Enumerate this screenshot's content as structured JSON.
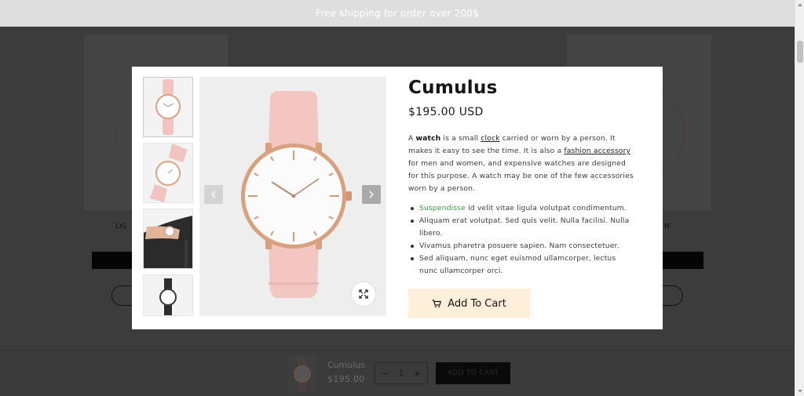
{
  "announcement": {
    "text": "Free shipping for order over 200$"
  },
  "modal": {
    "title": "Cumulus",
    "price": "$195.00 USD",
    "description": {
      "p1": "A ",
      "watch": "watch",
      "p2": " is a small ",
      "clock": "clock",
      "p3": " carried or worn by a person. It makes it easy to see the time. It is also a ",
      "fashion_accessory": "fashion accessory",
      "p4": " for men and women, and expensive watches are designed for this purpose. A watch may be one of the few accessories worn by a person."
    },
    "bullets": {
      "b1_highlight": "Suspendisse",
      "b1_rest": " id velit vitae ligula volutpat condimentum.",
      "b2": "Aliquam erat volutpat. Sed quis velit. Nulla facilisi. Nulla libero.",
      "b3": "Vivamus pharetra posuere sapien. Nam consectetuer.",
      "b4": "Sed aliquam, nunc eget euismod ullamcorper, lectus nunc ullamcorper orci."
    },
    "add_to_cart_label": "Add To Cart",
    "icons": {
      "prev": "chevron-left-icon",
      "next": "chevron-right-icon",
      "zoom": "expand-icon",
      "cart": "cart-icon"
    },
    "colors": {
      "accent_button": "#fdefd9",
      "highlight_green": "#3a9d3a",
      "strap_pink": "#f2c7c2",
      "case_rose_gold": "#d9a07e"
    }
  },
  "background_page": {
    "left_partial_label": "LIG",
    "right_partial_label": "H"
  },
  "sticky_bar": {
    "product_name": "Cumulus",
    "price": "$195.00",
    "qty_minus": "−",
    "qty_value": "1",
    "qty_plus": "+",
    "add_to_cart_label": "ADD TO CART"
  }
}
